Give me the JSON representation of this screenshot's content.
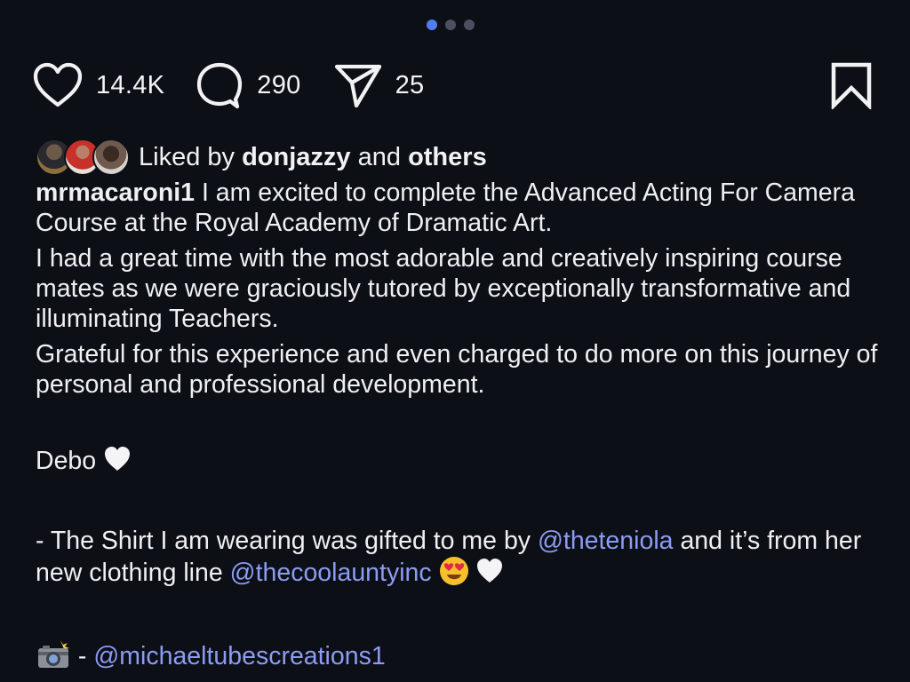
{
  "carousel": {
    "dots": [
      {
        "active": true
      },
      {
        "active": false
      },
      {
        "active": false
      }
    ]
  },
  "actions": {
    "likes_count": "14.4K",
    "comments_count": "290",
    "shares_count": "25",
    "icons": [
      "heart-icon",
      "comment-icon",
      "share-icon",
      "bookmark-icon"
    ]
  },
  "likes": {
    "prefix": "Liked by",
    "user": "donjazzy",
    "connector": "and",
    "others": "others"
  },
  "caption": {
    "username": "mrmacaroni1",
    "line1": "I am excited to complete the Advanced Acting For Camera Course at the Royal Academy of Dramatic Art.",
    "para2": "I had a great time with the most adorable and creatively inspiring course mates as we were graciously tutored by exceptionally transformative and illuminating Teachers.",
    "para3": "Grateful for this experience and even charged to do more on this journey of personal and professional development.",
    "signoff": "Debo",
    "shirt_text": "- The Shirt I am wearing was gifted to me by",
    "mention1": "@theteniola",
    "shirt_text2": "and it’s from her new clothing line",
    "mention2": "@thecoolauntyinc",
    "credit_dash": "-",
    "mention3": "@michaeltubescreations1"
  },
  "colors": {
    "background": "#0d0f16",
    "text": "#f0f0f3",
    "mention": "#8b9cf2",
    "dot_active": "#4f7df3",
    "dot_inactive": "#4b5060"
  }
}
